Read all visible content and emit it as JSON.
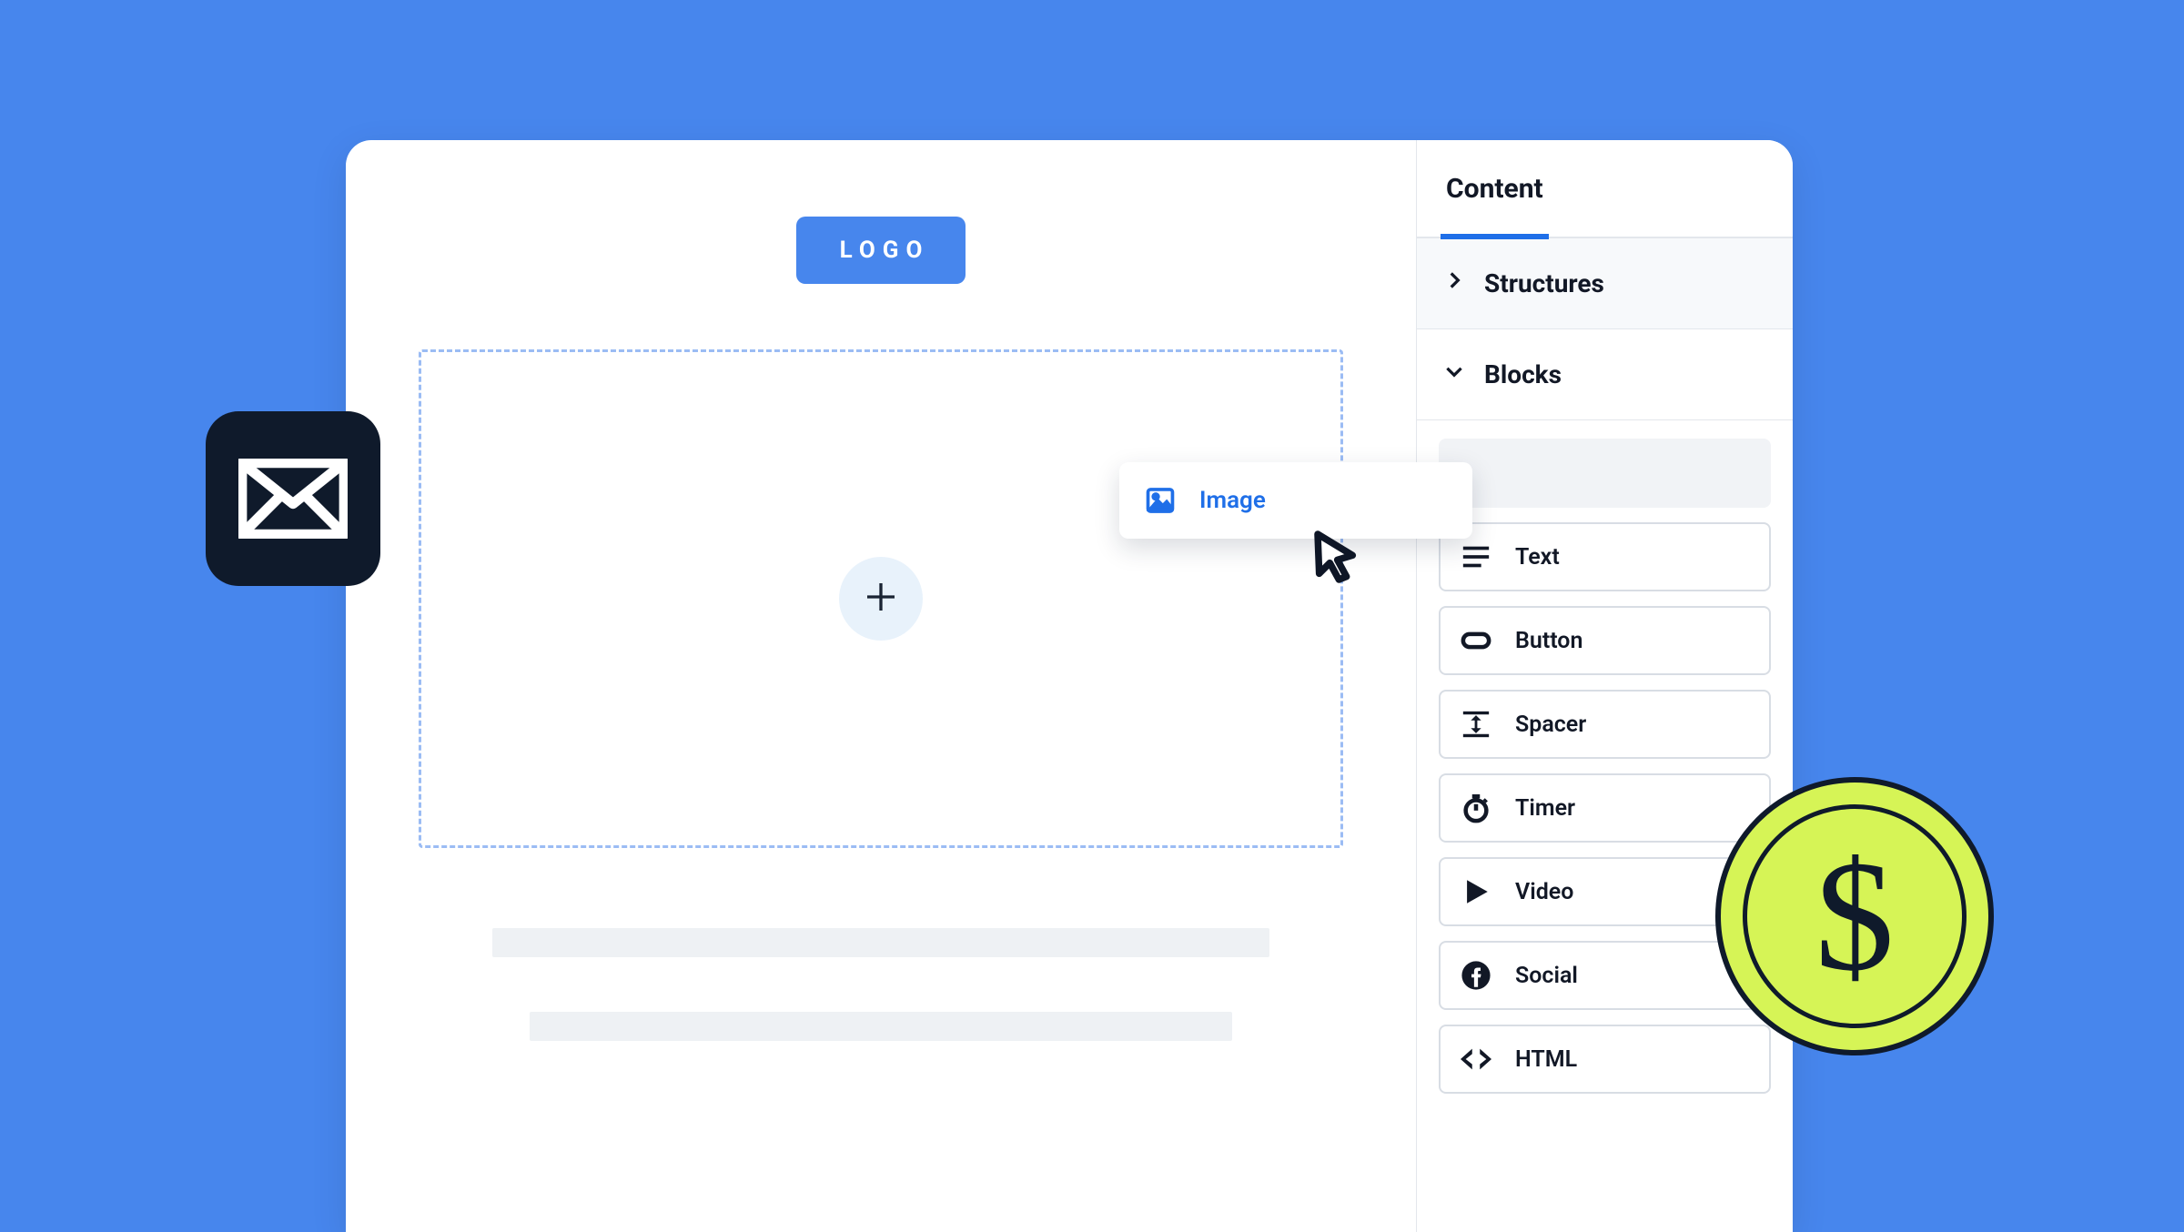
{
  "canvas": {
    "logo_label": "LOGO"
  },
  "drag": {
    "label": "Image"
  },
  "panel": {
    "tab_label": "Content",
    "sections": {
      "structures": "Structures",
      "blocks": "Blocks"
    },
    "blocks": {
      "text": "Text",
      "button": "Button",
      "spacer": "Spacer",
      "timer": "Timer",
      "video": "Video",
      "social": "Social",
      "html": "HTML"
    }
  },
  "decor": {
    "coin_symbol": "$"
  }
}
